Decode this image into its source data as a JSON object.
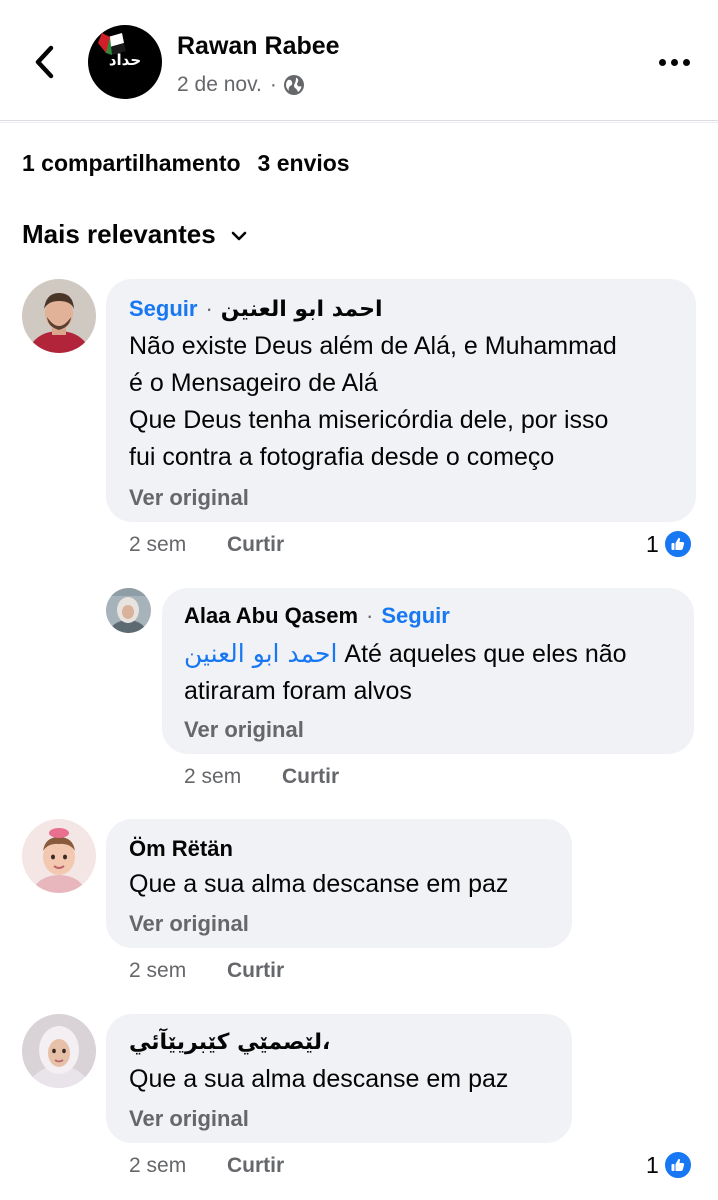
{
  "header": {
    "page_name": "Rawan Rabee",
    "post_date": "2 de nov.",
    "meta_separator": "·",
    "avatar_text": "حداد"
  },
  "stats": {
    "shares": "1 compartilhamento",
    "sends": "3 envios"
  },
  "filter": {
    "label": "Mais relevantes"
  },
  "comments": [
    {
      "author": "احمد ابو العنين",
      "follow": "Seguir",
      "separator": "·",
      "text_lines": [
        "Não existe Deus além de Alá, e Muhammad",
        "é o Mensageiro de Alá",
        "Que Deus tenha misericórdia dele, por isso",
        "fui contra a fotografia desde o começo"
      ],
      "see_original": "Ver original",
      "time": "2 sem",
      "like_label": "Curtir",
      "reaction_count": "1"
    },
    {
      "author": "Alaa Abu Qasem",
      "follow": "Seguir",
      "separator": "·",
      "mention": "احمد ابو العنين",
      "text_lines": [
        "Até aqueles que eles não",
        "atiraram foram alvos"
      ],
      "see_original": "Ver original",
      "time": "2 sem",
      "like_label": "Curtir"
    },
    {
      "author": "Öm Rëtän",
      "text_lines": [
        "Que a sua alma descanse em paz"
      ],
      "see_original": "Ver original",
      "time": "2 sem",
      "like_label": "Curtir"
    },
    {
      "author": "لێصمێي كێبريێآئي،",
      "text_lines": [
        "Que a sua alma descanse em paz"
      ],
      "see_original": "Ver original",
      "time": "2 sem",
      "like_label": "Curtir",
      "reaction_count": "1"
    }
  ],
  "colors": {
    "accent": "#1877f2",
    "bubble": "#f0f2f5",
    "secondary_text": "#65676b"
  }
}
